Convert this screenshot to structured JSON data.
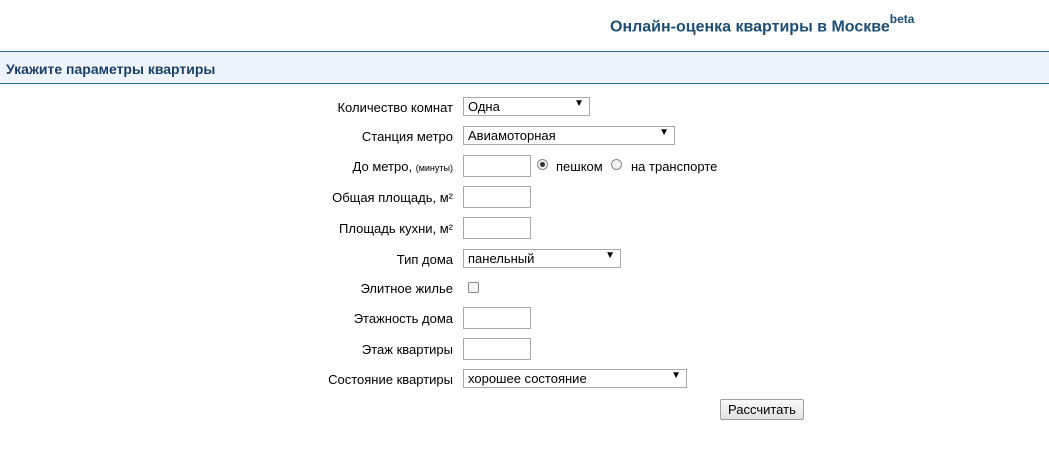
{
  "header": {
    "title": "Онлайн-оценка квартиры в Москве",
    "title_sup": "beta"
  },
  "section": {
    "title": "Укажите параметры квартиры"
  },
  "form": {
    "rooms": {
      "label": "Количество комнат",
      "value": "Одна"
    },
    "metro": {
      "label": "Станция метро",
      "value": "Авиамоторная"
    },
    "distance": {
      "label": "До метро,",
      "label_small": "(минуты)",
      "value": "",
      "radio_walk": "пешком",
      "radio_transport": "на транспорте",
      "selected": "пешком"
    },
    "total_area": {
      "label": "Общая площадь, м²",
      "value": ""
    },
    "kitchen_area": {
      "label": "Площадь кухни, м²",
      "value": ""
    },
    "house_type": {
      "label": "Тип дома",
      "value": "панельный"
    },
    "elite": {
      "label": "Элитное жилье",
      "checked": false
    },
    "floors": {
      "label": "Этажность дома",
      "value": ""
    },
    "floor": {
      "label": "Этаж квартиры",
      "value": ""
    },
    "condition": {
      "label": "Состояние квартиры",
      "value": "хорошее состояние"
    },
    "submit_label": "Рассчитать"
  }
}
